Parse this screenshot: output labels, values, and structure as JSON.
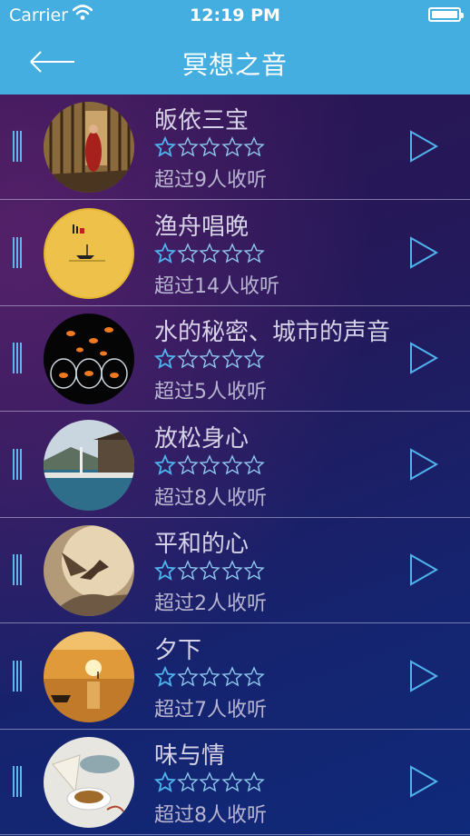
{
  "status_bar": {
    "carrier": "Carrier",
    "time": "12:19 PM"
  },
  "nav": {
    "title": "冥想之音"
  },
  "colors": {
    "header": "#43aedf",
    "accent": "#4fb4ee"
  },
  "tracks": [
    {
      "title": "皈依三宝",
      "listeners": "超过9人收听",
      "rating": 1,
      "image": "monk-corridor"
    },
    {
      "title": "渔舟唱晚",
      "listeners": "超过14人收听",
      "rating": 1,
      "image": "fishing-boat-moon"
    },
    {
      "title": "水的秘密、城市的声音",
      "listeners": "超过5人收听",
      "rating": 1,
      "image": "goldfish-bowls"
    },
    {
      "title": "放松身心",
      "listeners": "超过8人收听",
      "rating": 1,
      "image": "poolside-villa"
    },
    {
      "title": "平和的心",
      "listeners": "超过2人收听",
      "rating": 1,
      "image": "bird-on-hand"
    },
    {
      "title": "夕下",
      "listeners": "超过7人收听",
      "rating": 1,
      "image": "lake-sunset"
    },
    {
      "title": "味与情",
      "listeners": "超过8人收听",
      "rating": 1,
      "image": "tea-cup"
    }
  ]
}
